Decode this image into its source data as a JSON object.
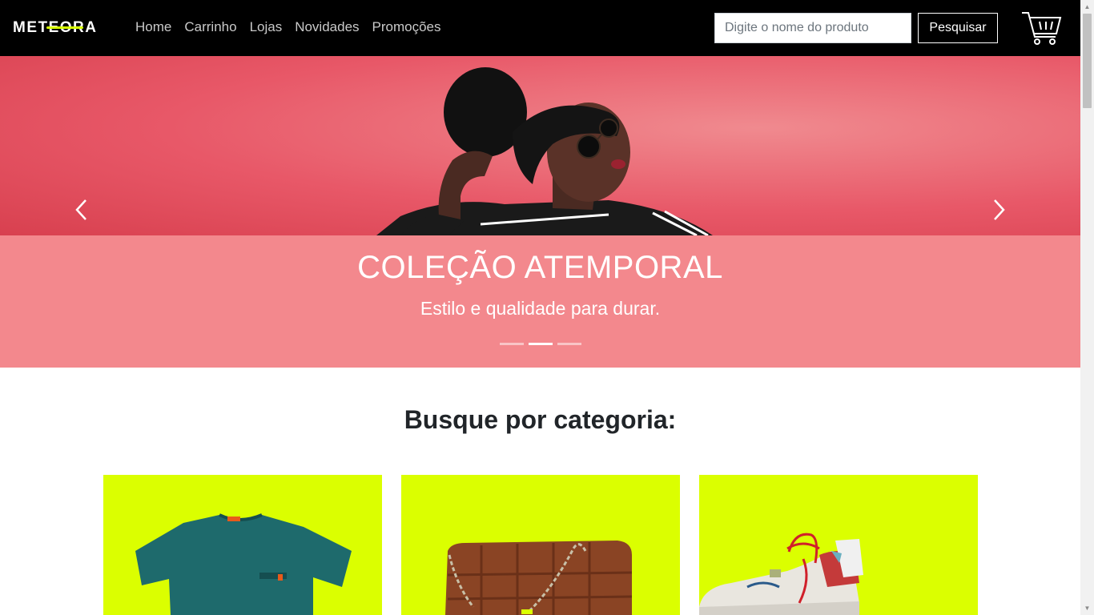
{
  "brand": {
    "logo": "METEORA",
    "accent": "#d8ff00"
  },
  "nav": {
    "links": [
      "Home",
      "Carrinho",
      "Lojas",
      "Novidades",
      "Promoções"
    ]
  },
  "search": {
    "placeholder": "Digite o nome do produto",
    "button": "Pesquisar"
  },
  "carousel": {
    "title": "COLEÇÃO ATEMPORAL",
    "subtitle": "Estilo e qualidade para durar.",
    "slide_count": 3,
    "active_slide": 2,
    "caption_color": "#f3888d"
  },
  "categories": {
    "heading": "Busque por categoria:",
    "card_color": "#dbff00",
    "items": [
      {
        "icon": "tshirt-image"
      },
      {
        "icon": "handbag-image"
      },
      {
        "icon": "sneaker-image"
      }
    ]
  }
}
